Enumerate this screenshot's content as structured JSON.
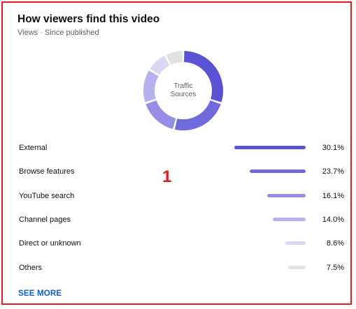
{
  "card": {
    "title": "How viewers find this video",
    "subtitle": "Views · Since published",
    "center_label_line1": "Traffic",
    "center_label_line2": "Sources",
    "marker": "1",
    "see_more_label": "SEE MORE"
  },
  "chart_data": {
    "type": "pie",
    "categories": [
      "External",
      "Browse features",
      "YouTube search",
      "Channel pages",
      "Direct or unknown",
      "Others"
    ],
    "values": [
      30.1,
      23.7,
      16.1,
      14.0,
      8.6,
      7.5
    ],
    "value_labels": [
      "30.1%",
      "23.7%",
      "16.1%",
      "14.0%",
      "8.6%",
      "7.5%"
    ],
    "colors": [
      "#5a52d4",
      "#6f6bdc",
      "#958ee6",
      "#b5b2ee",
      "#d8d8f3",
      "#e2e2e2"
    ]
  },
  "colors": {
    "border": "#e01c1c",
    "accent_link": "#065fd4"
  }
}
